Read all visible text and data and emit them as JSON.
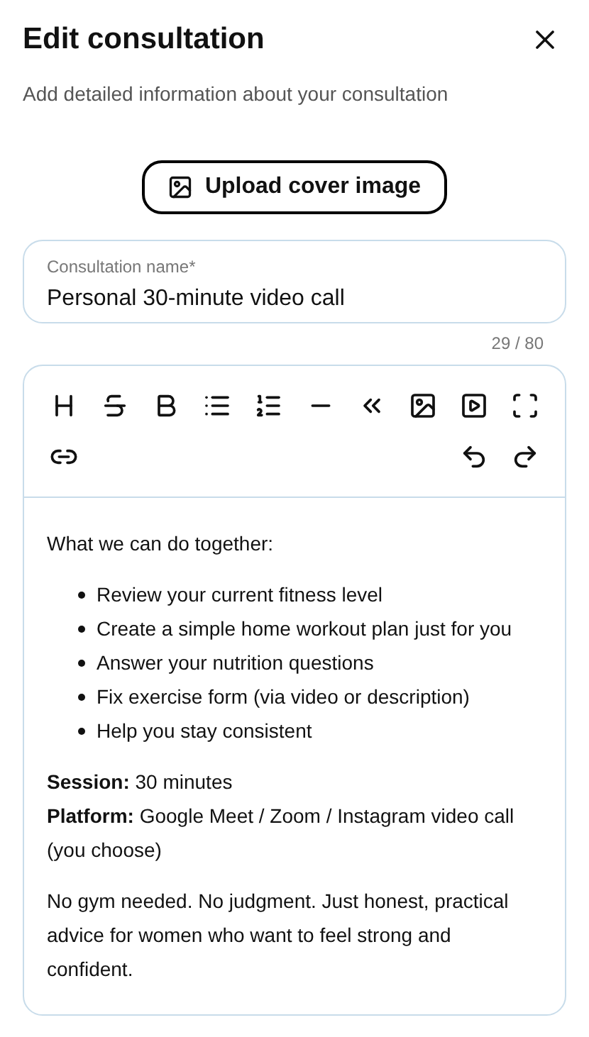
{
  "title": "Edit consultation",
  "subtitle": "Add detailed information about your consultation",
  "upload_button": "Upload cover image",
  "name_field": {
    "label": "Consultation name",
    "required_mark": "*",
    "value": "Personal 30-minute video call"
  },
  "counter": "29 / 80",
  "editor": {
    "intro": "What we can do together:",
    "bullets": [
      "Review your current fitness level",
      "Create a simple home workout plan just for you",
      "Answer your nutrition questions",
      "Fix exercise form (via video or description)",
      "Help you stay consistent"
    ],
    "details": [
      "**Session:** 30 minutes",
      "**Platform:** Google Meet / Zoom / Instagram video call (you choose)"
    ],
    "closing": "No gym needed. No judgment. Just honest, practical advice for women who want to feel strong and confident."
  }
}
